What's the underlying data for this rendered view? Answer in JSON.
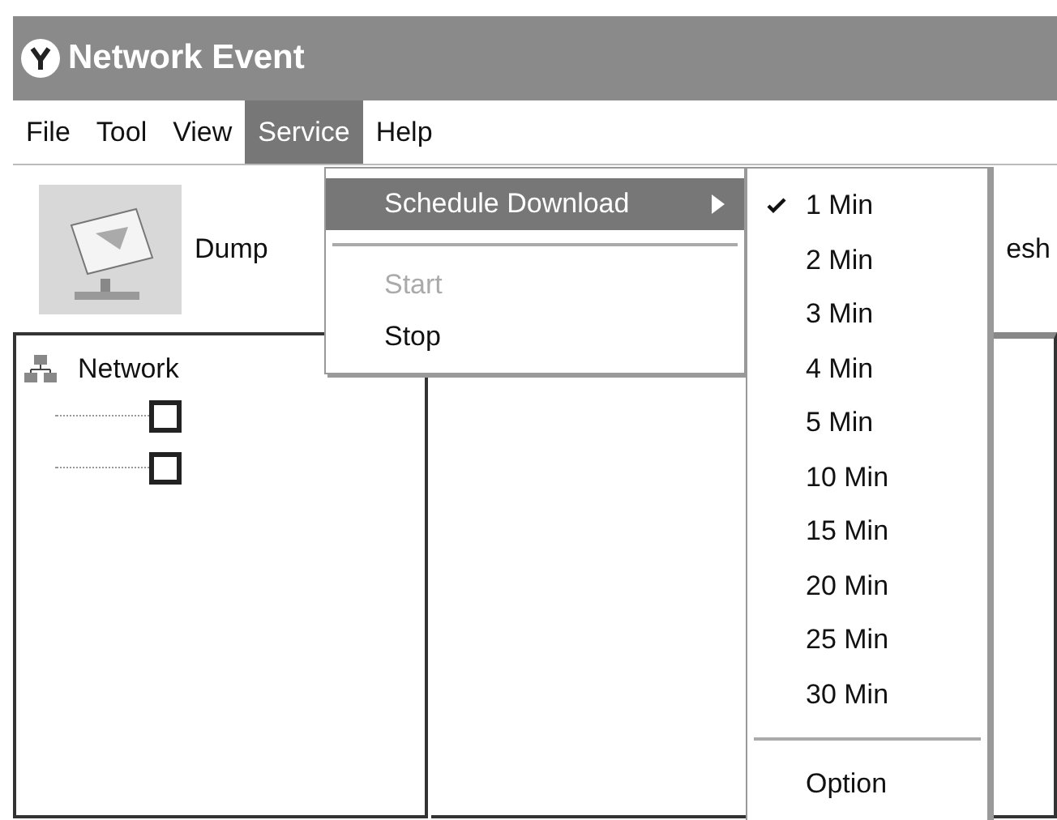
{
  "window": {
    "title": "Network Event"
  },
  "menu_bar": [
    {
      "label": "File",
      "selected": false
    },
    {
      "label": "Tool",
      "selected": false
    },
    {
      "label": "View",
      "selected": false
    },
    {
      "label": "Service",
      "selected": true
    },
    {
      "label": "Help",
      "selected": false
    }
  ],
  "toolbar": [
    {
      "label": "Dump",
      "kind": "icon_button"
    },
    {
      "label": "esh",
      "kind": "text_button"
    }
  ],
  "tree": {
    "label": "Network",
    "children": [
      {
        "checked": false
      },
      {
        "checked": false
      }
    ]
  },
  "service_menu": [
    {
      "kind": "submenu",
      "label": "Schedule Download",
      "selected": true,
      "disabled": false
    },
    {
      "kind": "separator"
    },
    {
      "kind": "item",
      "label": "Start",
      "selected": false,
      "disabled": true
    },
    {
      "kind": "item",
      "label": "Stop",
      "selected": false,
      "disabled": false
    }
  ],
  "schedule_submenu": [
    {
      "kind": "item",
      "label": "1 Min",
      "checked": true
    },
    {
      "kind": "item",
      "label": "2 Min",
      "checked": false
    },
    {
      "kind": "item",
      "label": "3 Min",
      "checked": false
    },
    {
      "kind": "item",
      "label": "4 Min",
      "checked": false
    },
    {
      "kind": "item",
      "label": "5 Min",
      "checked": false
    },
    {
      "kind": "item",
      "label": "10 Min",
      "checked": false
    },
    {
      "kind": "item",
      "label": "15 Min",
      "checked": false
    },
    {
      "kind": "item",
      "label": "20 Min",
      "checked": false
    },
    {
      "kind": "item",
      "label": "25 Min",
      "checked": false
    },
    {
      "kind": "item",
      "label": "30 Min",
      "checked": false
    },
    {
      "kind": "separator"
    },
    {
      "kind": "item",
      "label": "Option",
      "checked": false
    }
  ]
}
